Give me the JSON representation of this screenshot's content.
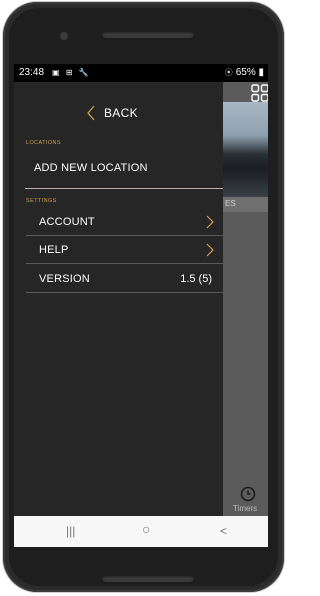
{
  "statusbar": {
    "time": "23:48",
    "left_icons": "▣ ⊞ 🔧",
    "battery": "65%"
  },
  "drawer": {
    "back_label": "BACK",
    "locations_header": "LOCATIONS",
    "add_location_label": "ADD NEW LOCATION",
    "settings_header": "SETTINGS",
    "items": [
      {
        "label": "ACCOUNT",
        "has_chevron": true
      },
      {
        "label": "HELP",
        "has_chevron": true
      },
      {
        "label": "VERSION",
        "value": "1.5 (5)"
      }
    ]
  },
  "background": {
    "side_text": "ES",
    "timer_label": "Timers"
  },
  "navbar": {
    "recent": "|||",
    "home": "○",
    "back": "<"
  },
  "colors": {
    "accent": "#c9a24f",
    "drawer_bg": "#262626"
  },
  "icons": [
    "chevron-left-icon",
    "chevron-right-icon",
    "grid-icon",
    "timer-icon",
    "wifi-icon",
    "battery-icon"
  ]
}
